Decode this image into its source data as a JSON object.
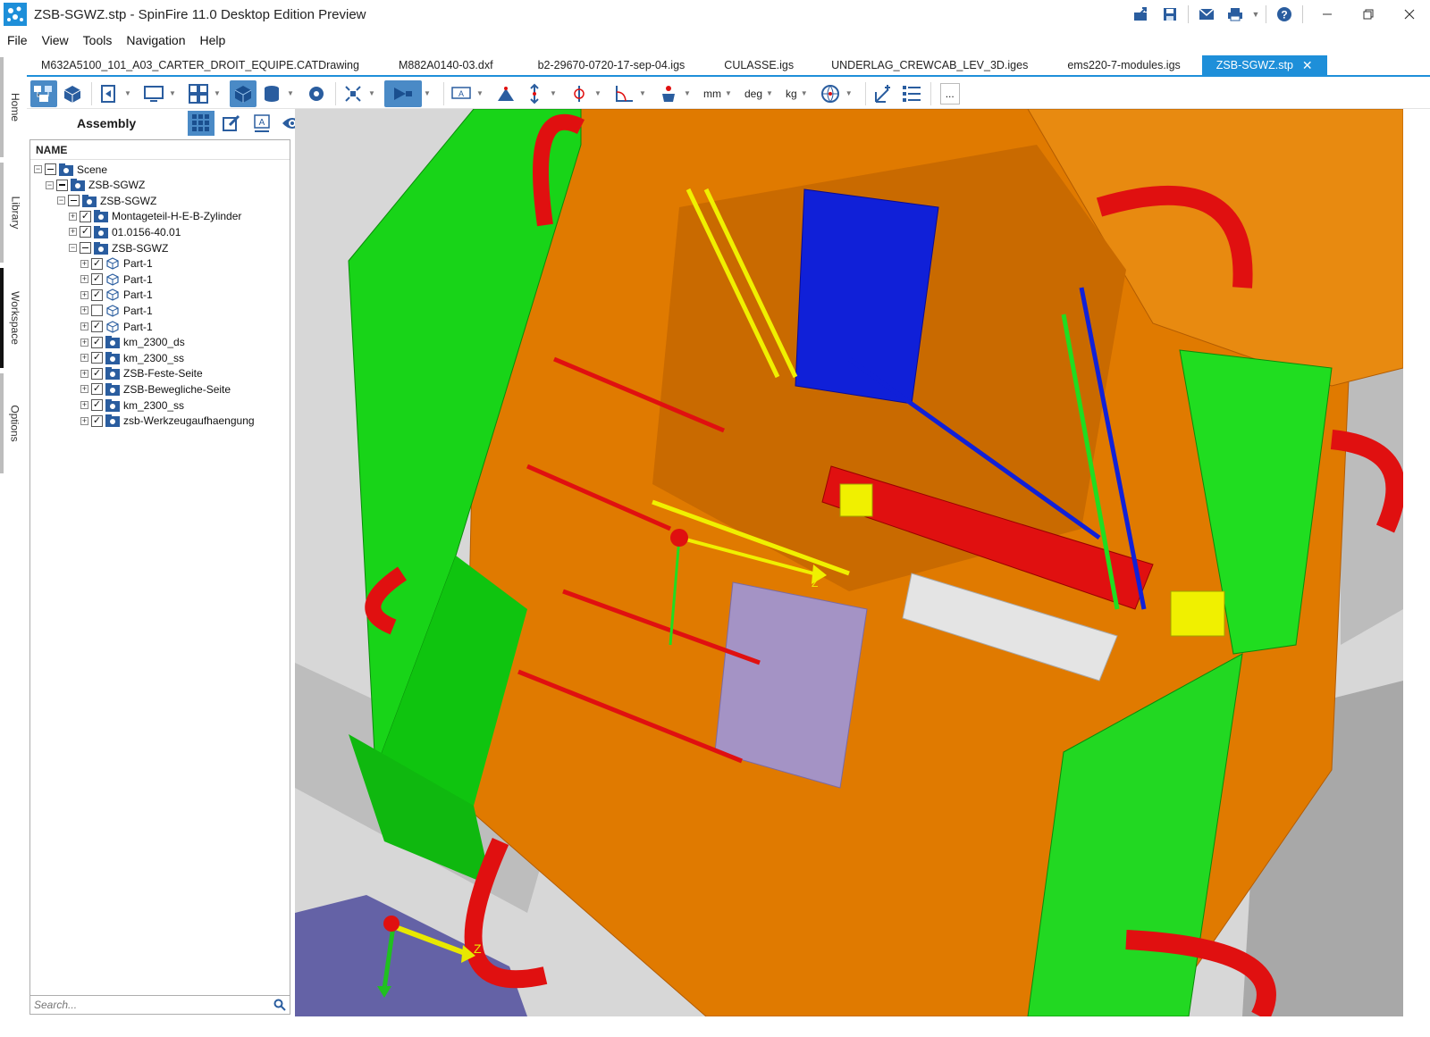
{
  "window": {
    "title": "ZSB-SGWZ.stp - SpinFire 11.0 Desktop Edition Preview"
  },
  "quick_access": [
    "share-icon",
    "save-icon",
    "email-icon",
    "print-icon",
    "help-icon"
  ],
  "menu": [
    "File",
    "View",
    "Tools",
    "Navigation",
    "Help"
  ],
  "side_tabs": [
    "Home",
    "Library",
    "Workspace",
    "Options"
  ],
  "active_side_tab": "Workspace",
  "doc_tabs": [
    "M632A5100_101_A03_CARTER_DROIT_EQUIPE.CATDrawing",
    "M882A0140-03.dxf",
    "b2-29670-0720-17-sep-04.igs",
    "CULASSE.igs",
    "UNDERLAG_CREWCAB_LEV_3D.iges",
    "ems220-7-modules.igs",
    "ZSB-SGWZ.stp"
  ],
  "active_doc_tab": "ZSB-SGWZ.stp",
  "toolbar": {
    "units": {
      "length": "mm",
      "angle": "deg",
      "mass": "kg"
    },
    "more_label": "..."
  },
  "panel": {
    "title": "Assembly",
    "column_header": "NAME",
    "search_placeholder": "Search..."
  },
  "tree": [
    {
      "label": "Scene",
      "depth": 0,
      "expander": "−",
      "check": "partial",
      "icon": "folder"
    },
    {
      "label": "ZSB-SGWZ",
      "depth": 1,
      "expander": "−",
      "check": "partial",
      "icon": "folder"
    },
    {
      "label": "ZSB-SGWZ",
      "depth": 2,
      "expander": "−",
      "check": "partial",
      "icon": "folder"
    },
    {
      "label": "Montageteil-H-E-B-Zylinder",
      "depth": 3,
      "expander": "+",
      "check": "checked",
      "icon": "folder"
    },
    {
      "label": "01.0156-40.01",
      "depth": 3,
      "expander": "+",
      "check": "checked",
      "icon": "folder"
    },
    {
      "label": "ZSB-SGWZ",
      "depth": 3,
      "expander": "−",
      "check": "partial",
      "icon": "folder"
    },
    {
      "label": "Part-1",
      "depth": 4,
      "expander": "+",
      "check": "checked",
      "icon": "cube"
    },
    {
      "label": "Part-1",
      "depth": 4,
      "expander": "+",
      "check": "checked",
      "icon": "cube"
    },
    {
      "label": "Part-1",
      "depth": 4,
      "expander": "+",
      "check": "checked",
      "icon": "cube"
    },
    {
      "label": "Part-1",
      "depth": 4,
      "expander": "+",
      "check": "unchecked",
      "icon": "cube"
    },
    {
      "label": "Part-1",
      "depth": 4,
      "expander": "+",
      "check": "checked",
      "icon": "cube"
    },
    {
      "label": "km_2300_ds",
      "depth": 4,
      "expander": "+",
      "check": "checked",
      "icon": "folder"
    },
    {
      "label": "km_2300_ss",
      "depth": 4,
      "expander": "+",
      "check": "checked",
      "icon": "folder"
    },
    {
      "label": "ZSB-Feste-Seite",
      "depth": 4,
      "expander": "+",
      "check": "checked",
      "icon": "folder"
    },
    {
      "label": "ZSB-Bewegliche-Seite",
      "depth": 4,
      "expander": "+",
      "check": "checked",
      "icon": "folder"
    },
    {
      "label": "km_2300_ss",
      "depth": 4,
      "expander": "+",
      "check": "checked",
      "icon": "folder"
    },
    {
      "label": "zsb-Werkzeugaufhaengung",
      "depth": 4,
      "expander": "+",
      "check": "checked",
      "icon": "folder"
    }
  ],
  "viewport": {
    "triad_axis_label": "Z",
    "model_axis_label": "Z",
    "colors": {
      "background": "#d7d7d7",
      "orange": "#e07a00",
      "green": "#12d812",
      "red": "#e01010",
      "blue": "#1020d8",
      "gray": "#c8c8c8",
      "purple": "#6060a8",
      "yellow": "#f0f000",
      "lavender": "#9a98e8"
    }
  }
}
